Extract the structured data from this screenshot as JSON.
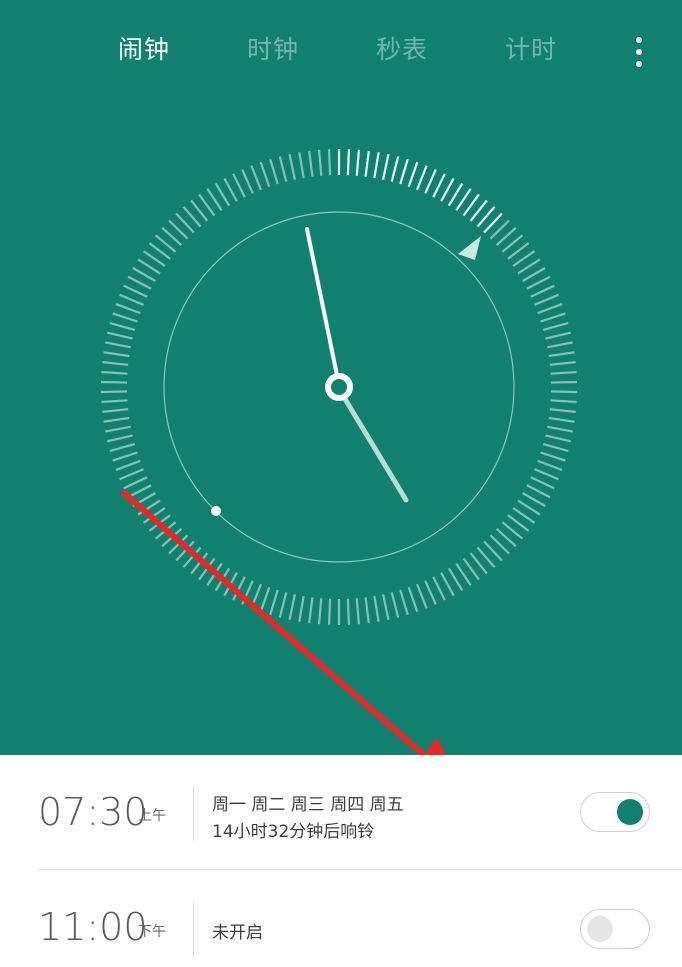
{
  "tabs": [
    {
      "label": "闹钟",
      "active": true
    },
    {
      "label": "时钟",
      "active": false
    },
    {
      "label": "秒表",
      "active": false
    },
    {
      "label": "计时",
      "active": false
    }
  ],
  "colors": {
    "header_bg": "#11806f",
    "accent": "#11806f",
    "annotation_arrow": "#e8262a"
  },
  "icons": {
    "more": "more-vertical-icon"
  },
  "alarms": [
    {
      "time": "07:30",
      "ampm": "上午",
      "days": "周一 周二 周三 周四 周五",
      "subtitle": "14小时32分钟后响铃",
      "enabled": true
    },
    {
      "time": "11:00",
      "ampm": "下午",
      "status": "未开启",
      "enabled": false
    }
  ]
}
